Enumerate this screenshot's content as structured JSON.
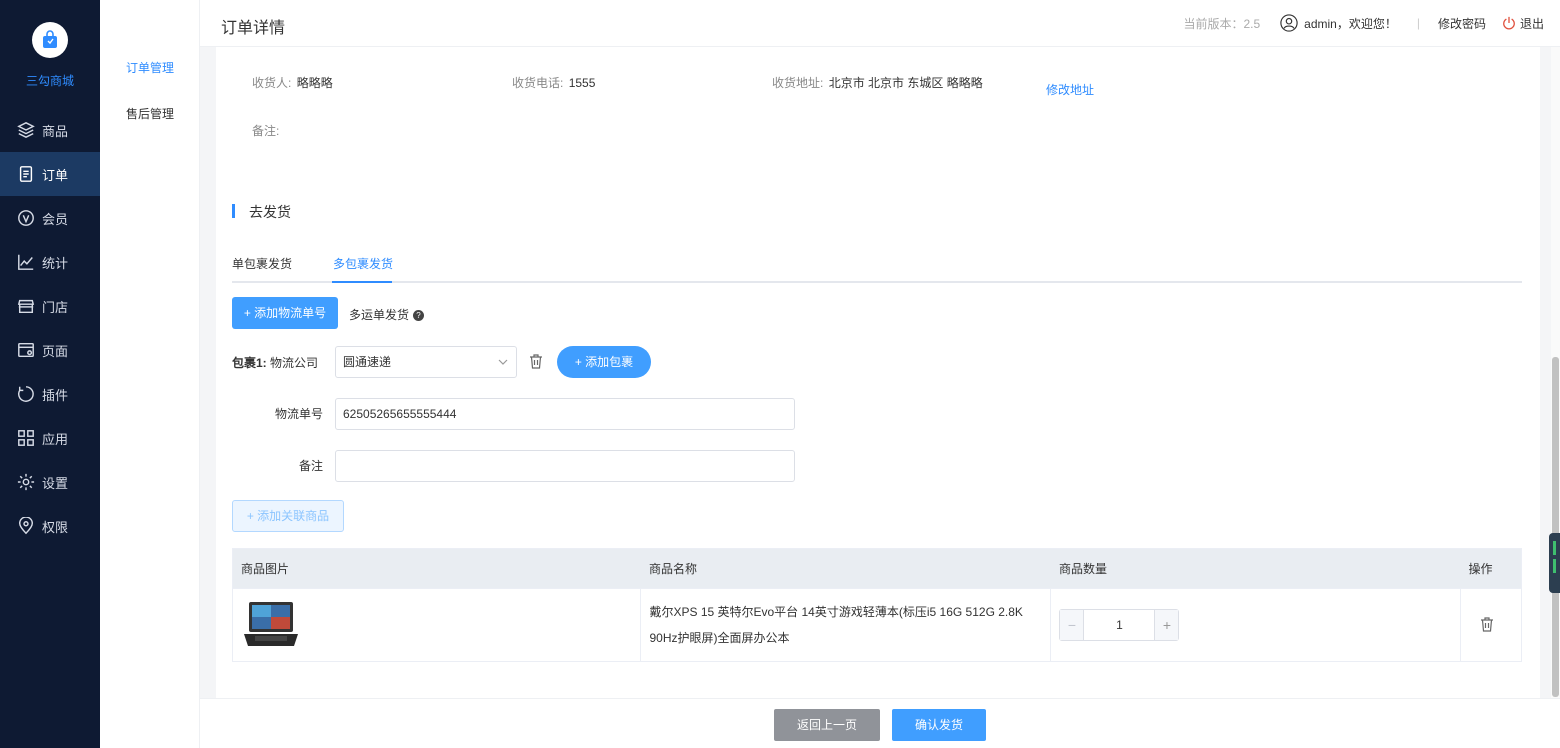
{
  "sidebar": {
    "brand": "三勾商城",
    "items": [
      {
        "label": "商品",
        "icon": "layers-icon"
      },
      {
        "label": "订单",
        "icon": "order-doc-icon"
      },
      {
        "label": "会员",
        "icon": "vip-icon"
      },
      {
        "label": "统计",
        "icon": "chart-icon"
      },
      {
        "label": "门店",
        "icon": "store-icon"
      },
      {
        "label": "页面",
        "icon": "page-icon"
      },
      {
        "label": "插件",
        "icon": "plugin-icon"
      },
      {
        "label": "应用",
        "icon": "apps-icon"
      },
      {
        "label": "设置",
        "icon": "gear-icon"
      },
      {
        "label": "权限",
        "icon": "location-shield-icon"
      }
    ],
    "active_index": 1
  },
  "submenu": {
    "items": [
      "订单管理",
      "售后管理"
    ]
  },
  "header": {
    "title": "订单详情",
    "version": "当前版本：2.5",
    "user": "admin，欢迎您！",
    "divider": "|",
    "change_password": "修改密码",
    "logout": "退出"
  },
  "receiver": {
    "name_label": "收货人:",
    "name": "略略略",
    "phone_label": "收货电话:",
    "phone": "1555",
    "address_label": "收货地址:",
    "address": "北京市 北京市 东城区 略略略",
    "edit_address": "修改地址",
    "remark_label": "备注:"
  },
  "ship": {
    "section_title": "去发货",
    "tabs": [
      "单包裹发货",
      "多包裹发货"
    ],
    "active_tab": 1,
    "add_tracking": "+ 添加物流单号",
    "multi_label": "多运单发货",
    "help": "?",
    "package_label": "包裹1:",
    "company_label": "物流公司",
    "company_value": "圆通速递",
    "add_package": "+ 添加包裹",
    "tracking_label": "物流单号",
    "tracking_value": "62505265655555444",
    "remark_label": "备注",
    "remark_value": "",
    "add_related": "+ 添加关联商品"
  },
  "table": {
    "headers": [
      "商品图片",
      "商品名称",
      "商品数量",
      "操作"
    ],
    "rows": [
      {
        "name": "戴尔XPS 15 英特尔Evo平台 14英寸游戏轻薄本(标压i5 16G 512G 2.8K 90Hz护眼屏)全面屏办公本",
        "qty": "1"
      }
    ]
  },
  "footer": {
    "back": "返回上一页",
    "confirm": "确认发货"
  },
  "colors": {
    "sidebar_bg": "#0e1a33",
    "accent": "#409eff",
    "gray_button": "#909399"
  }
}
